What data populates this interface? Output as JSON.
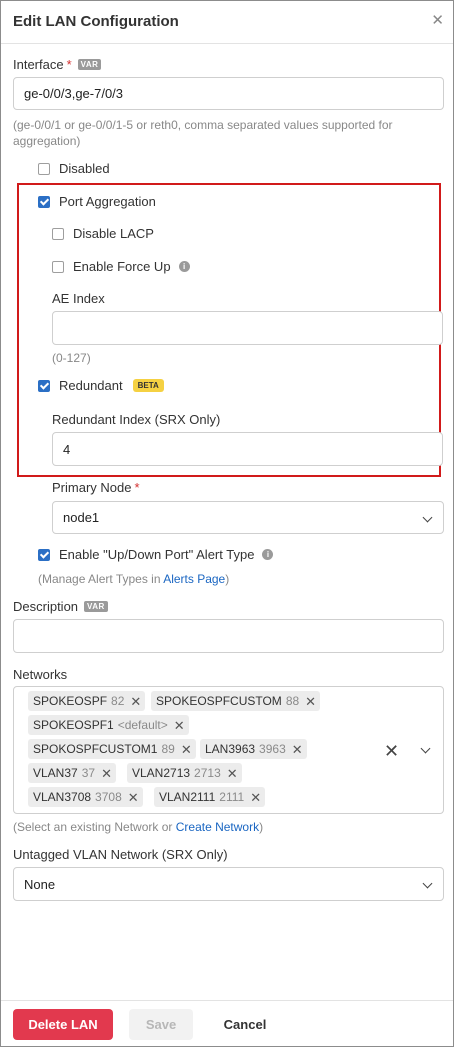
{
  "header": {
    "title": "Edit LAN Configuration",
    "close_glyph": "✕"
  },
  "interface": {
    "label": "Interface",
    "required_mark": "*",
    "var_badge": "VAR",
    "value": "ge-0/0/3,ge-7/0/3",
    "hint_line1": "(ge-0/0/1 or ge-0/0/1-5 or reth0, comma separated values supported for",
    "hint_line2": "aggregation)"
  },
  "disabled": {
    "label": "Disabled",
    "checked": false
  },
  "port_aggregation": {
    "label": "Port Aggregation",
    "checked": true
  },
  "disable_lacp": {
    "label": "Disable LACP",
    "checked": false
  },
  "enable_force_up": {
    "label": "Enable Force Up",
    "checked": false,
    "info_glyph": "i"
  },
  "ae_index": {
    "label": "AE Index",
    "value": "",
    "hint": "(0-127)"
  },
  "redundant": {
    "label": "Redundant",
    "checked": true,
    "badge": "BETA"
  },
  "redundant_index": {
    "label": "Redundant Index (SRX Only)",
    "value": "4"
  },
  "primary_node": {
    "label": "Primary Node",
    "required_mark": "*",
    "value": "node1"
  },
  "alert_type": {
    "label": "Enable \"Up/Down Port\" Alert Type",
    "checked": true,
    "info_glyph": "i",
    "hint_prefix": "(Manage Alert Types in ",
    "hint_link": "Alerts Page",
    "hint_suffix": ")"
  },
  "description": {
    "label": "Description",
    "var_badge": "VAR",
    "value": ""
  },
  "networks": {
    "label": "Networks",
    "chips": [
      {
        "name": "SPOKEOSPF",
        "sub": "82"
      },
      {
        "name": "SPOKEOSPFCUSTOM",
        "sub": "88"
      },
      {
        "name": "SPOKEOSPF1",
        "sub": "<default>"
      },
      {
        "name": "SPOKOSPFCUSTOM1",
        "sub": "89"
      },
      {
        "name": "LAN3963",
        "sub": "3963"
      },
      {
        "name": "VLAN37",
        "sub": "37"
      },
      {
        "name": "VLAN2713",
        "sub": "2713"
      },
      {
        "name": "VLAN3708",
        "sub": "3708"
      },
      {
        "name": "VLAN2111",
        "sub": "2111"
      }
    ],
    "chip_remove_glyph": "✕",
    "clear_glyph": "✕",
    "hint_prefix": "(Select an existing Network or ",
    "hint_link": "Create Network",
    "hint_suffix": ")"
  },
  "untagged_vlan": {
    "label": "Untagged VLAN Network (SRX Only)",
    "value": "None"
  },
  "footer": {
    "delete_label": "Delete LAN",
    "save_label": "Save",
    "cancel_label": "Cancel"
  },
  "colors": {
    "accent": "#2b6fc5",
    "danger": "#e2394e",
    "highlight_border": "#d11a1a",
    "beta": "#f5d142"
  },
  "icons": {
    "close": "close-icon",
    "info": "info-icon",
    "chevron": "chevron-down-icon",
    "clear": "clear-icon"
  }
}
